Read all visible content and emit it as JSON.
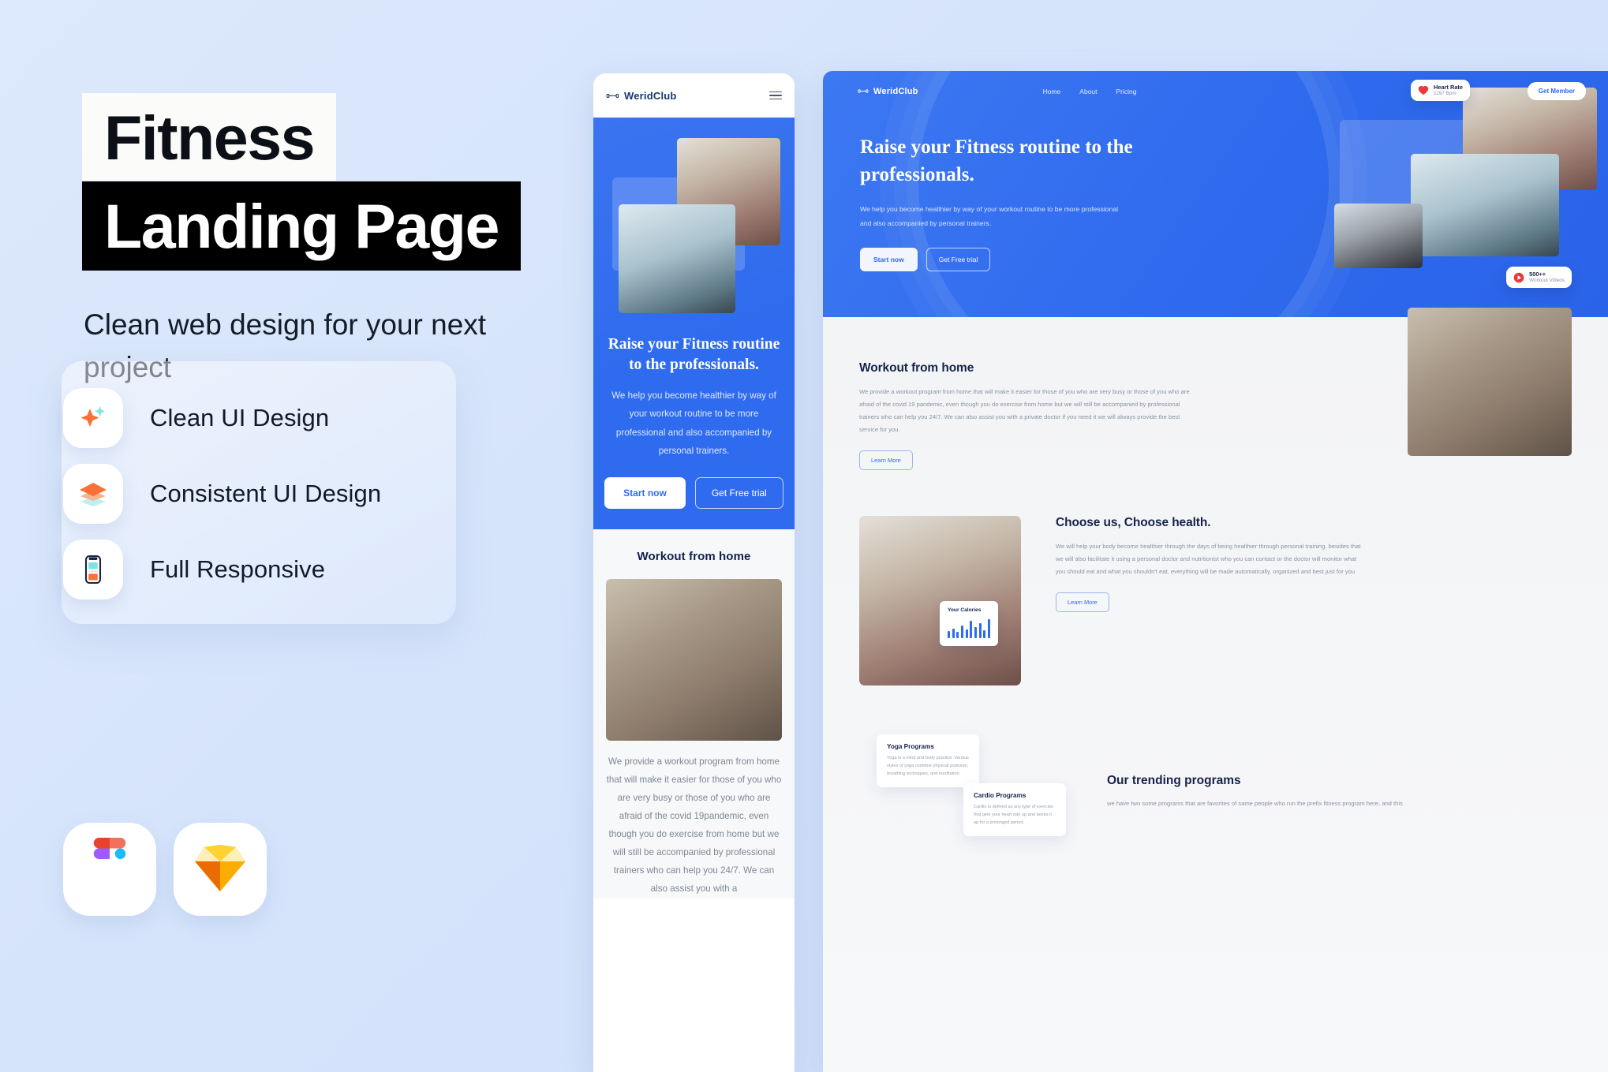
{
  "left": {
    "title_line1": "Fitness",
    "title_line2": "Landing Page",
    "subtitle": "Clean web design for your next project",
    "features": [
      {
        "icon": "sparkle-icon",
        "label": "Clean UI Design"
      },
      {
        "icon": "layers-icon",
        "label": "Consistent UI Design"
      },
      {
        "icon": "mobile-phone-icon",
        "label": "Full Responsive"
      }
    ],
    "tools": [
      {
        "icon": "figma-logo",
        "name": "Figma"
      },
      {
        "icon": "sketch-logo",
        "name": "Sketch"
      }
    ]
  },
  "mobile": {
    "brand": "WeridClub",
    "menu_icon": "hamburger-menu-icon",
    "hero": {
      "heading": "Raise your Fitness routine to the professionals.",
      "paragraph": "We help you become healthier by way of your workout routine to be more professional and also accompanied by personal trainers.",
      "primary_button": "Start now",
      "secondary_button": "Get Free trial"
    },
    "section": {
      "heading": "Workout from home",
      "paragraph": "We provide a workout program from home that will make it easier for those of you who are very busy or those of you who are afraid of the covid 19pandemic, even though you do exercise from home but we will still be accompanied by professional trainers who can help you 24/7. We can also assist you with a"
    }
  },
  "desktop": {
    "brand": "WeridClub",
    "nav": [
      "Home",
      "About",
      "Pricing"
    ],
    "cta": "Get Member",
    "hero": {
      "heading": "Raise your Fitness routine to the professionals.",
      "paragraph": "We help you become healthier by way of your workout routine to be more professional and also accompanied by personal trainers.",
      "primary_button": "Start now",
      "secondary_button": "Get Free trial"
    },
    "badges": {
      "heart_rate": {
        "icon": "heart-icon",
        "title": "Heart Rate",
        "value": "1197 Bpm"
      },
      "workout_videos": {
        "icon": "play-icon",
        "title": "500++",
        "value": "Workout Videos"
      }
    },
    "workout": {
      "heading": "Workout from home",
      "paragraph": "We provide a workout program from home that will make it easier for those of you who are very busy or those of you who are afraid of the covid 19 pandemic, even though you do exercise from home but we will still be accompanied by professional trainers who can help you 24/7. We can also assist you with a private doctor if you need it we will always provide the best service for you.",
      "button": "Learn More"
    },
    "choose": {
      "heading": "Choose us, Choose health.",
      "paragraph": "We will help your body become healthier through the days of being healthier through personal training, besides that we will also facilitate it using a personal doctor and nutritionist who you can contact or the doctor will monitor what you should eat and what you shouldn't eat, everything will be made automatically, organized and best just for you",
      "button": "Learn More",
      "calories_card": {
        "title": "Your Calories",
        "bars": [
          9,
          12,
          8,
          16,
          11,
          22,
          14,
          19,
          10,
          24
        ]
      }
    },
    "programs": [
      {
        "title": "Yoga Programs",
        "desc": "Yoga is a mind and body practice. Various styles of yoga combine physical postures, breathing techniques, and meditation."
      },
      {
        "title": "Cardio Programs",
        "desc": "Cardio is defined as any type of exercise that gets your heart rate up and keeps it up for a prolonged period."
      }
    ],
    "trending": {
      "heading": "Our trending programs",
      "paragraph": "we have two some programs that are favorites of same people who run the prefix fitness program here, and this"
    }
  },
  "colors": {
    "brand_blue": "#2f6bee",
    "dark_navy": "#16224a",
    "accent_orange": "#f97136",
    "accent_teal": "#7fe3e0",
    "page_bg": "#d6e4fb"
  }
}
